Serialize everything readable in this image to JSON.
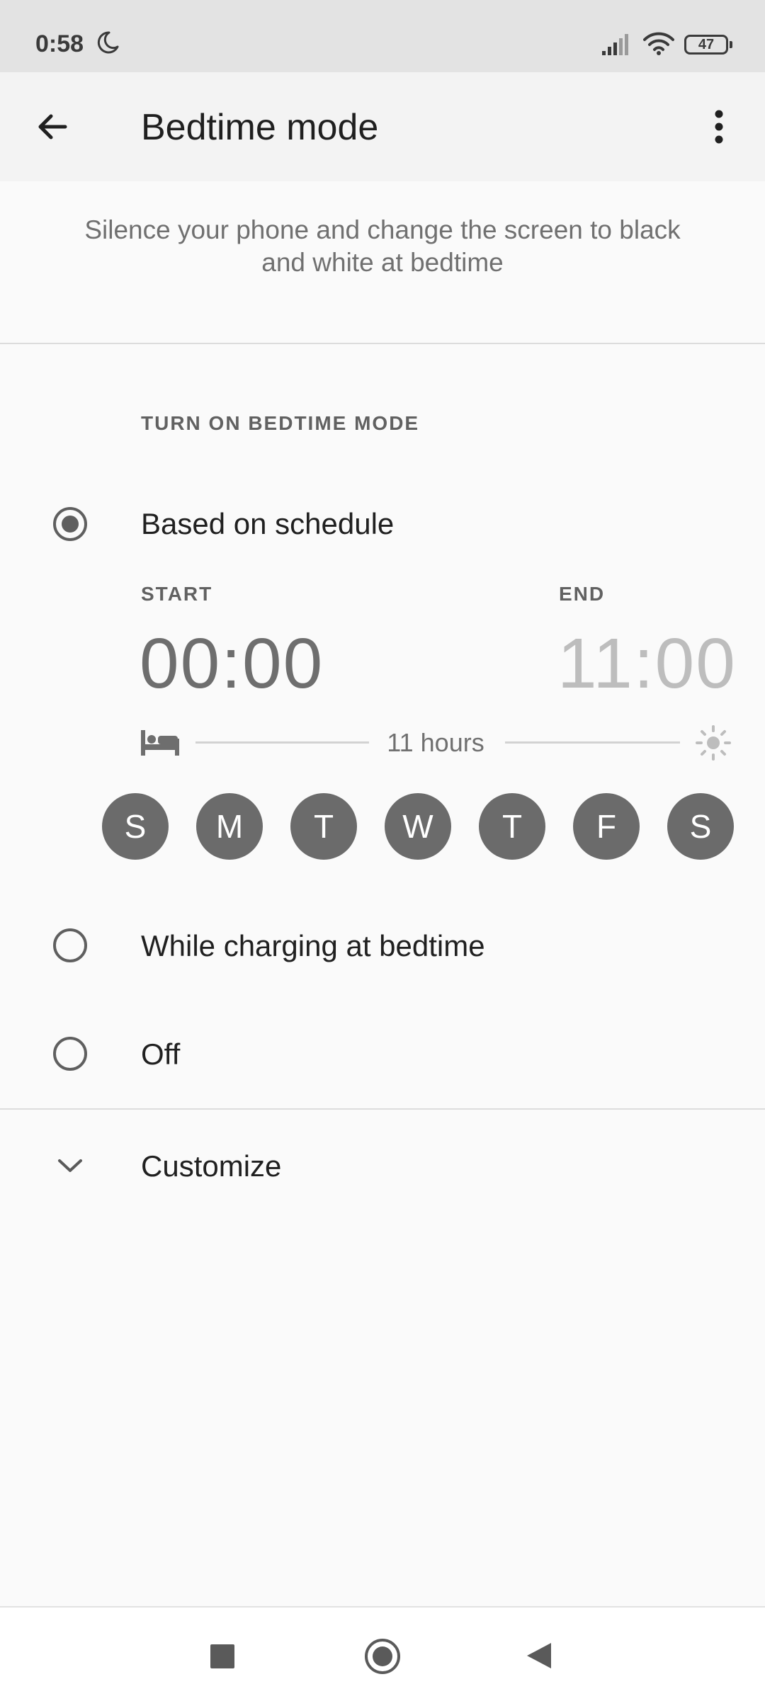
{
  "status_bar": {
    "time": "0:58",
    "battery": "47",
    "icons": [
      "moon-icon",
      "signal-icon",
      "wifi-icon",
      "battery-icon"
    ]
  },
  "app_bar": {
    "title": "Bedtime mode",
    "back_icon": "arrow-back-icon",
    "menu_icon": "more-vert-icon"
  },
  "description": "Silence your phone and change the screen to black and white at bedtime",
  "section": {
    "header": "TURN ON BEDTIME MODE"
  },
  "options": {
    "schedule": {
      "label": "Based on schedule",
      "selected": true
    },
    "charging": {
      "label": "While charging at bedtime",
      "selected": false
    },
    "off": {
      "label": "Off",
      "selected": false
    }
  },
  "schedule": {
    "start_label": "START",
    "start_time": "00:00",
    "end_label": "END",
    "end_time": "11:00",
    "duration": "11 hours",
    "days": [
      "S",
      "M",
      "T",
      "W",
      "T",
      "F",
      "S"
    ]
  },
  "customize": {
    "label": "Customize",
    "icon": "chevron-down-icon"
  },
  "nav_bar": {
    "icons": [
      "recents-square-icon",
      "home-circle-icon",
      "back-triangle-icon"
    ]
  },
  "colors": {
    "primary_text": "#202020",
    "secondary_text": "#707070",
    "accent_gray": "#6b6b6b",
    "end_time": "#bdbdbd",
    "start_time": "#6e6e6e"
  }
}
